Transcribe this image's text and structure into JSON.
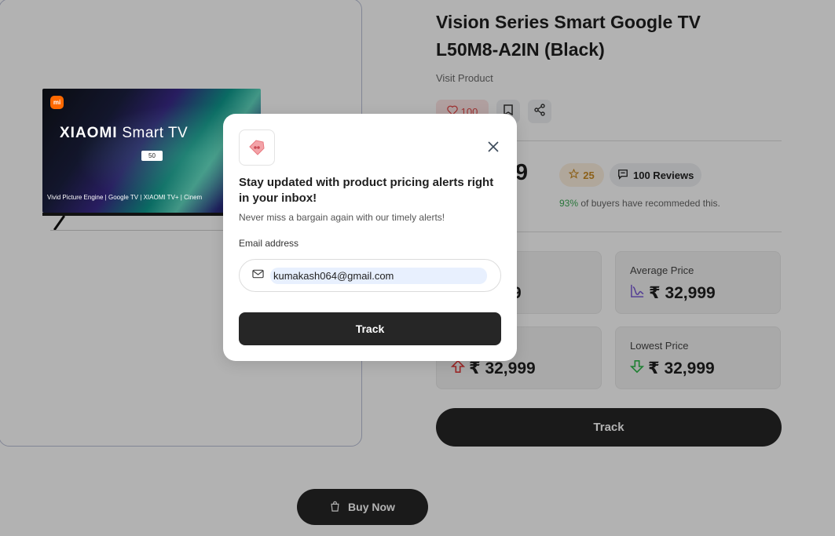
{
  "product": {
    "title_lines": [
      "Vision Series Smart Google TV",
      "L50M8-A2IN (Black)"
    ],
    "visit_label": "Visit Product",
    "likes": "100",
    "price_partial": "9",
    "rating": "25",
    "reviews": "100 Reviews",
    "buyers_pct": "93%",
    "buyers_text": " of buyers have recommeded this."
  },
  "tv_image": {
    "brand_logo": "mi",
    "brand_text_a": "XIAOMI",
    "brand_text_b": " Smart TV",
    "size": "50",
    "bottom_text": "Vivid Picture Engine  |  Google TV  |  XIAOMI TV+  |  Cinem"
  },
  "price_cards": [
    {
      "label": "",
      "value": "99",
      "icon": "none"
    },
    {
      "label": "Average Price",
      "value": "₹ 32,999",
      "icon": "chart-icon"
    },
    {
      "label": "",
      "value": "₹ 32,999",
      "icon": "arrow-up-icon"
    },
    {
      "label": "Lowest Price",
      "value": "₹ 32,999",
      "icon": "arrow-down-icon"
    }
  ],
  "track_button": "Track",
  "buy_now": "Buy Now",
  "modal": {
    "heading": "Stay updated with product pricing alerts right in your inbox!",
    "subtext": "Never miss a bargain again with our timely alerts!",
    "email_label": "Email address",
    "email_value": "kumakash064@gmail.com",
    "track_label": "Track"
  },
  "colors": {
    "accent_dark": "#262626",
    "like_red": "#e24848",
    "rating_gold": "#c98a23",
    "buyers_green": "#3daa55",
    "arrow_up": "#e03a3a",
    "arrow_down": "#2fb84a",
    "chart_purple": "#7b5cd6"
  }
}
